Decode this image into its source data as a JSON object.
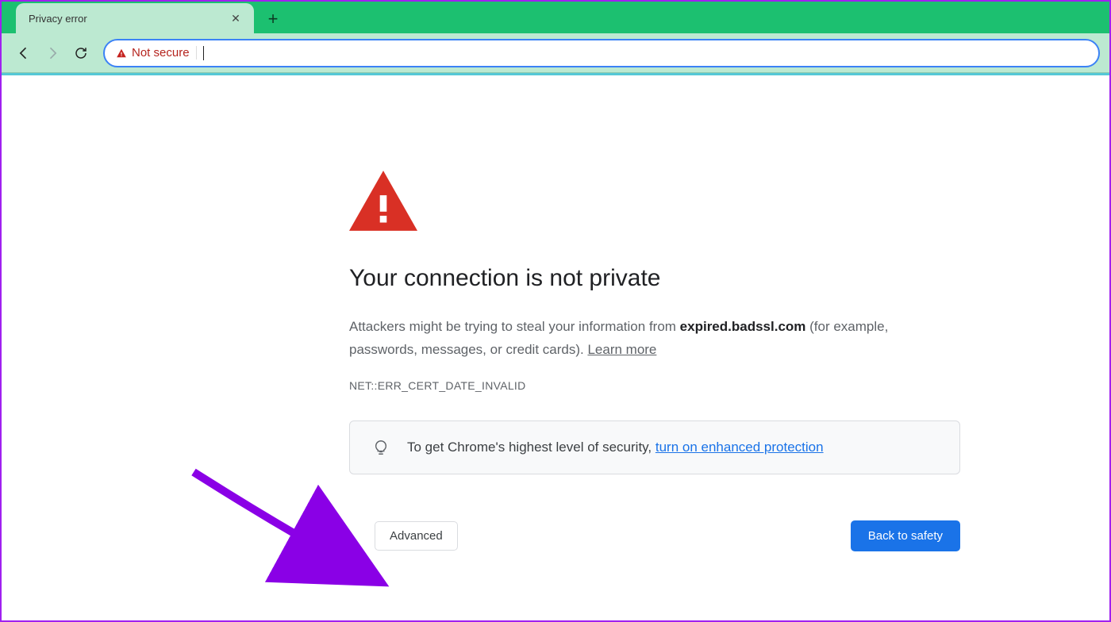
{
  "browser": {
    "tab_title": "Privacy error",
    "security_chip": "Not secure",
    "url_value": ""
  },
  "page": {
    "heading": "Your connection is not private",
    "desc_before": "Attackers might be trying to steal your information from ",
    "desc_domain": "expired.badssl.com",
    "desc_after": " (for example, passwords, messages, or credit cards). ",
    "learn_more": "Learn more",
    "error_code": "NET::ERR_CERT_DATE_INVALID",
    "promo_text": "To get Chrome's highest level of security, ",
    "promo_link": "turn on enhanced protection",
    "advanced_label": "Advanced",
    "back_label": "Back to safety"
  }
}
